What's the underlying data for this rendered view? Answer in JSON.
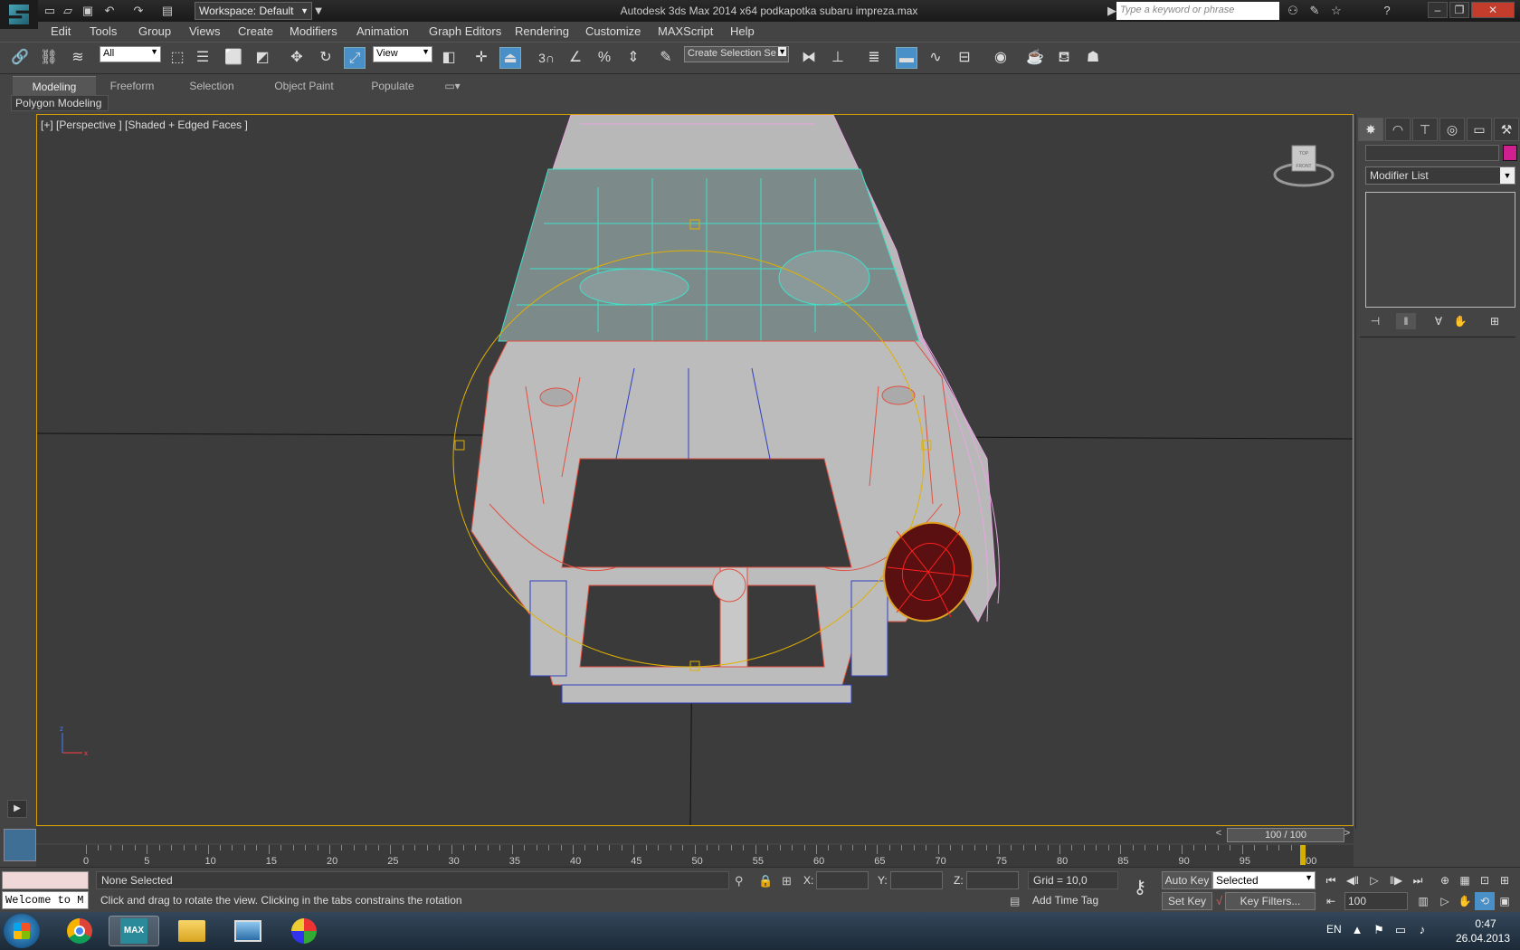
{
  "titlebar": {
    "workspace": "Workspace: Default",
    "app_title": "Autodesk 3ds Max  2014 x64      podkapotka subaru impreza.max",
    "search_placeholder": "Type a keyword or phrase"
  },
  "menu": [
    "Edit",
    "Tools",
    "Group",
    "Views",
    "Create",
    "Modifiers",
    "Animation",
    "Graph Editors",
    "Rendering",
    "Customize",
    "MAXScript",
    "Help"
  ],
  "toolbar": {
    "filter_select": "All",
    "ref_coord_select": "View",
    "selection_set": "Create Selection Se",
    "snap_label": "3"
  },
  "ribbon": {
    "tabs": [
      "Modeling",
      "Freeform",
      "Selection",
      "Object Paint",
      "Populate"
    ],
    "panel": "Polygon Modeling"
  },
  "viewport": {
    "label": "[+] [Perspective ] [Shaded + Edged Faces ]",
    "viewcube_top": "TOP",
    "viewcube_front": "FRONT",
    "axis_z": "z",
    "axis_x": "x"
  },
  "command_panel": {
    "modifier_list": "Modifier List"
  },
  "timeline": {
    "slider": "100 / 100",
    "slider_prev": "<",
    "slider_next": ">",
    "ticks": [
      "0",
      "5",
      "10",
      "15",
      "20",
      "25",
      "30",
      "35",
      "40",
      "45",
      "50",
      "55",
      "60",
      "65",
      "70",
      "75",
      "80",
      "85",
      "90",
      "95",
      "100"
    ]
  },
  "status": {
    "maxscript_listener": "Welcome to M",
    "selection": "None Selected",
    "prompt": "Click and drag to rotate the view.  Clicking in the tabs constrains the rotation",
    "x_label": "X:",
    "y_label": "Y:",
    "z_label": "Z:",
    "grid": "Grid = 10,0",
    "add_time_tag": "Add Time Tag",
    "auto_key": "Auto Key",
    "set_key": "Set Key",
    "key_mode": "Selected",
    "key_filters": "Key Filters...",
    "current_frame": "100"
  },
  "taskbar": {
    "lang": "EN",
    "time": "0:47",
    "date": "26.04.2013",
    "app_max_label": "MAX"
  }
}
